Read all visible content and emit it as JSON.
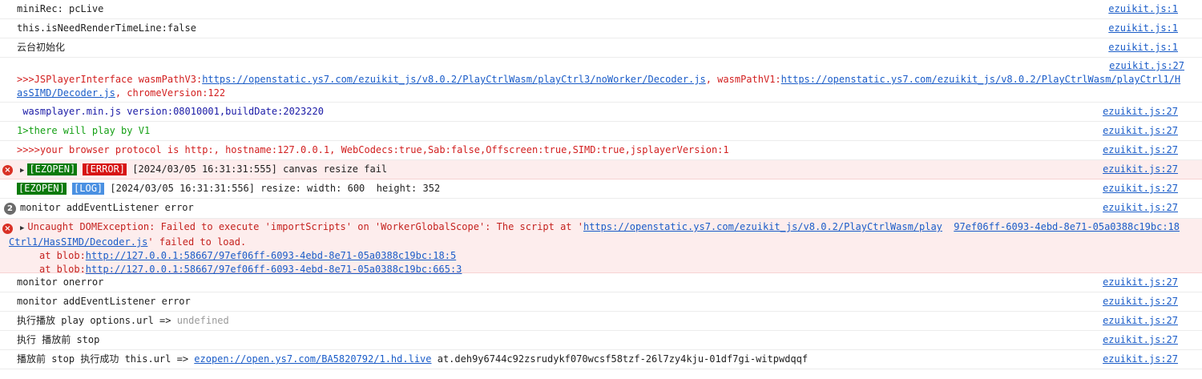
{
  "source_short": "ezuikit.js:1",
  "source_long": "ezuikit.js:27",
  "row1": "miniRec: pcLive",
  "row2": "this.isNeedRenderTimeLine:false",
  "row3": "云台初始化",
  "row4": {
    "prefix": ">>>JSPlayerInterface wasmPathV3:",
    "link1": "https://openstatic.ys7.com/ezuikit_js/v8.0.2/PlayCtrlWasm/playCtrl3/noWorker/Decoder.js",
    "mid": ", wasmPathV1:",
    "link2": "https://openstatic.ys7.com/ezuikit_js/v8.0.2/PlayCtrlWasm/playCtrl1/HasSIMD/Decoder.js",
    "suffix": ", chromeVersion:122"
  },
  "row5": " wasmplayer.min.js version:08010001,buildDate:2023220",
  "row6": "1>there will play by V1",
  "row7": ">>>>your browser protocol is http:, hostname:127.0.0.1, WebCodecs:true,Sab:false,Offscreen:true,SIMD:true,jsplayerVersion:1",
  "row8": {
    "tag1": "[EZOPEN]",
    "tag2": "[ERROR]",
    "text": " [2024/03/05 16:31:31:555] canvas resize fail"
  },
  "row9": {
    "tag1": "[EZOPEN]",
    "tag2": "[LOG]",
    "text": " [2024/03/05 16:31:31:556] resize: width: 600  height: 352"
  },
  "row10": {
    "count": "2",
    "text": "monitor addEventListener error"
  },
  "row11": {
    "prefix": "Uncaught DOMException: Failed to execute 'importScripts' on 'WorkerGlobalScope': The script at '",
    "link1": "https://openstatic.ys7.com/ezuikit_js/v8.0.2/PlayCtrlWasm/play",
    "link1b": "Ctrl1/HasSIMD/Decoder.js",
    "source": "97ef06ff-6093-4ebd-8e71-05a0388c19bc:18",
    "suffix": "' failed to load.",
    "stack1_prefix": "at blob:",
    "stack1_link": "http://127.0.0.1:58667/97ef06ff-6093-4ebd-8e71-05a0388c19bc:18:5",
    "stack2_prefix": "at blob:",
    "stack2_link": "http://127.0.0.1:58667/97ef06ff-6093-4ebd-8e71-05a0388c19bc:665:3"
  },
  "row12": "monitor onerror",
  "row13": "monitor addEventListener error",
  "row14": {
    "text": "执行播放 play options.url => ",
    "value": "undefined"
  },
  "row15": "执行 播放前 stop",
  "row16": {
    "prefix": "播放前 stop 执行成功 this.url => ",
    "link": "ezopen://open.ys7.com/BA5820792/1.hd.live",
    "suffix": " at.deh9y6744c92zsrudykf070wcsf58tzf-26l7zy4kju-01df7gi-witpwdqqf"
  }
}
